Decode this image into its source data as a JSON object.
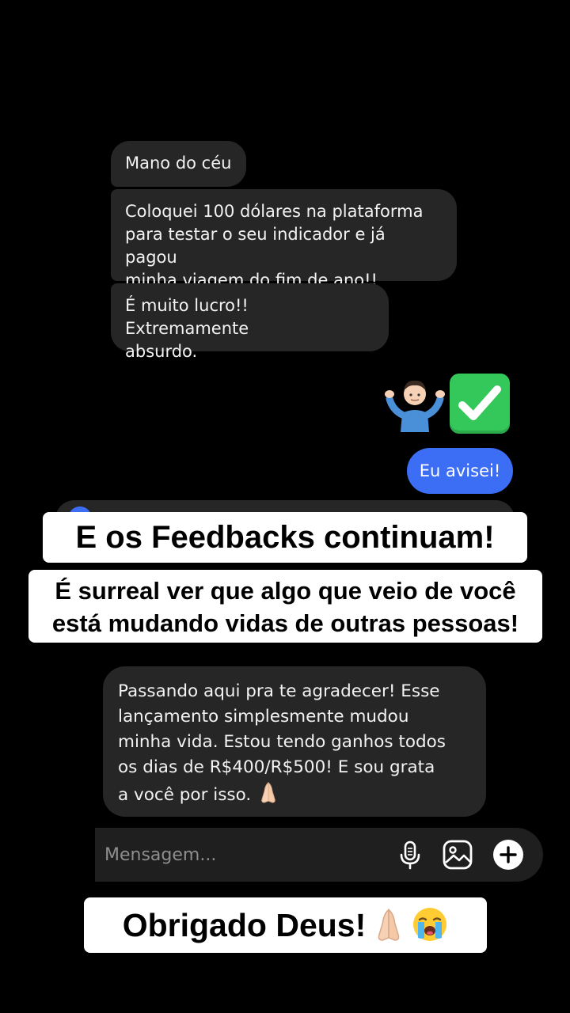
{
  "received_messages": [
    "Mano do céu",
    "Coloquei 100 dólares na plataforma\npara testar o seu indicador e já pagou\nminha viagem do fim de ano!!",
    "É muito lucro!! Extremamente\nabsurdo."
  ],
  "sent_emoji": [
    "person-shrugging-emoji",
    "check-mark-button-emoji"
  ],
  "sent_message": "Eu avisei!",
  "overlay": {
    "headline": "E os Feedbacks continuam!",
    "subheadline": "É surreal ver que algo que veio de você\nestá mudando vidas de outras pessoas!",
    "footer": "Obrigado Deus!",
    "footer_emoji": [
      "folded-hands-emoji",
      "loudly-crying-face-emoji"
    ]
  },
  "feedback_message": "Passando aqui pra te agradecer! Esse\nlançamento simplesmente mudou\nminha vida. Estou tendo ganhos todos\nos dias de R$400/R$500! E sou grata\na você por isso. ",
  "composer": {
    "placeholder": "Mensagem...",
    "icons": [
      "microphone-icon",
      "gallery-icon",
      "plus-icon"
    ]
  },
  "colors": {
    "background": "#000000",
    "received_bubble": "#262626",
    "sent_bubble": "#3b6ef5",
    "banner": "#ffffff"
  }
}
